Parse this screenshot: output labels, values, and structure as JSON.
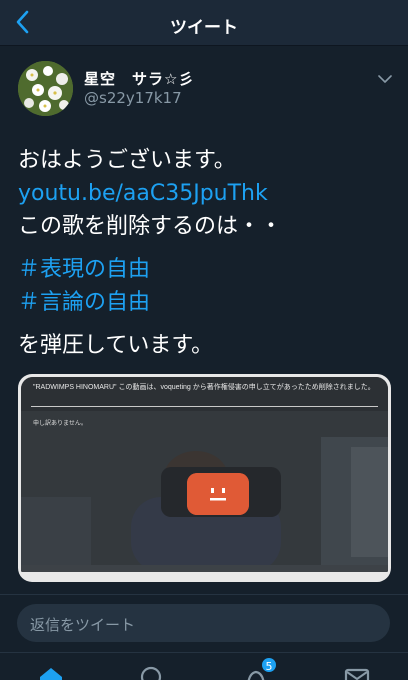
{
  "header": {
    "title": "ツイート"
  },
  "author": {
    "name": "星空　サラ☆彡",
    "handle": "@s22y17k17"
  },
  "tweet": {
    "lines": [
      "おはようございます。",
      "youtu.be/aaC35JpuThk",
      "この歌を削除するのは・・",
      "＃表現の自由",
      "＃言論の自由",
      "を弾圧しています。"
    ]
  },
  "media": {
    "message": "\"RADWIMPS HINOMARU\" この動画は、voqueting から著作権侵害の申し立てがあったため削除されました。",
    "sub": "申し訳ありません。"
  },
  "reply": {
    "placeholder": "返信をツイート"
  },
  "tabbar": {
    "notifications_count": "5"
  },
  "colors": {
    "background": "#15202b",
    "accent": "#1da1f2",
    "secondary_text": "#8899a6"
  }
}
